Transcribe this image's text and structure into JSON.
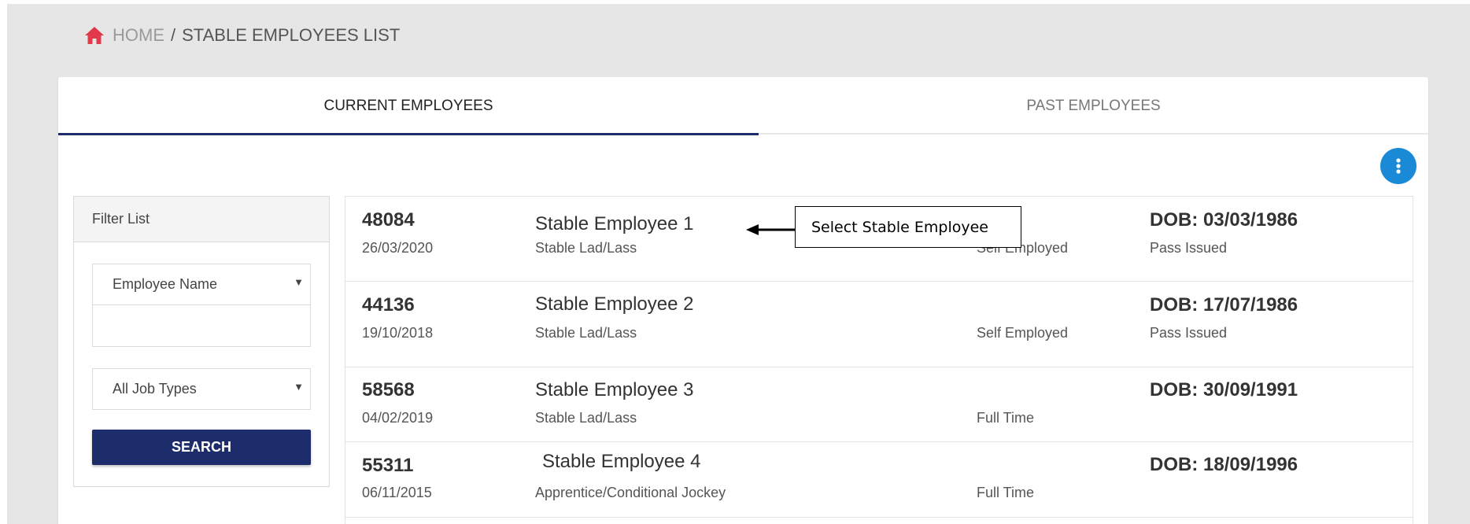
{
  "breadcrumb": {
    "home": "HOME",
    "separator": "/",
    "current": "STABLE EMPLOYEES LIST"
  },
  "tabs": [
    {
      "label": "CURRENT EMPLOYEES",
      "active": true
    },
    {
      "label": "PAST EMPLOYEES",
      "active": false
    }
  ],
  "filter": {
    "title": "Filter List",
    "name_select": "Employee Name",
    "name_value": "",
    "job_select": "All Job Types",
    "search_label": "SEARCH"
  },
  "employees": [
    {
      "id": "48084",
      "date": "26/03/2020",
      "name": "Stable Employee 1",
      "role": "Stable Lad/Lass",
      "employment": "Self Employed",
      "dob": "DOB: 03/03/1986",
      "pass": "Pass Issued"
    },
    {
      "id": "44136",
      "date": "19/10/2018",
      "name": "Stable Employee 2",
      "role": "Stable Lad/Lass",
      "employment": "Self Employed",
      "dob": "DOB: 17/07/1986",
      "pass": "Pass Issued"
    },
    {
      "id": "58568",
      "date": "04/02/2019",
      "name": "Stable Employee 3",
      "role": "Stable Lad/Lass",
      "employment": "Full Time",
      "dob": "DOB: 30/09/1991",
      "pass": ""
    },
    {
      "id": "55311",
      "date": "06/11/2015",
      "name": "Stable Employee 4",
      "role": "Apprentice/Conditional Jockey",
      "employment": "Full Time",
      "dob": "DOB: 18/09/1996",
      "pass": ""
    }
  ],
  "annotation": {
    "text": "Select Stable Employee"
  },
  "colors": {
    "home_icon": "#e2394b",
    "primary": "#1d2d6b",
    "fab": "#1a8ad6",
    "background": "#e6e6e6"
  },
  "icons": {
    "home": "home-icon",
    "more": "more-vertical-icon",
    "dropdown": "caret-down-icon"
  }
}
